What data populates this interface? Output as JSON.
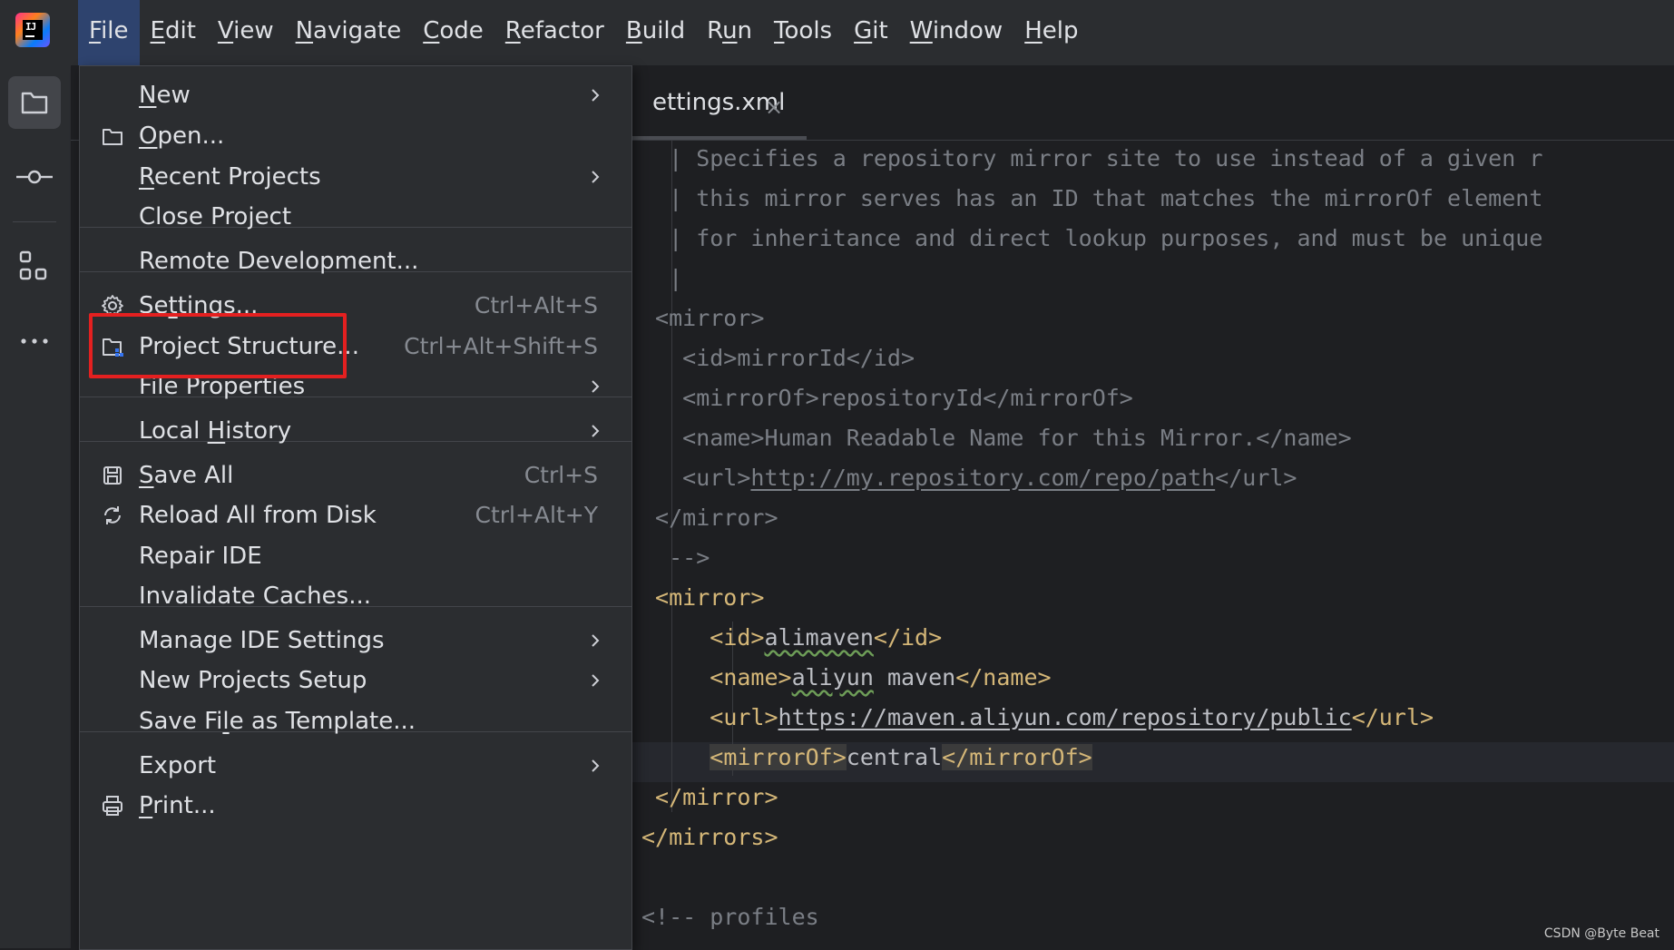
{
  "menubar": {
    "items": [
      "File",
      "Edit",
      "View",
      "Navigate",
      "Code",
      "Refactor",
      "Build",
      "Run",
      "Tools",
      "Git",
      "Window",
      "Help"
    ],
    "mnemonics": [
      "F",
      "E",
      "V",
      "N",
      "C",
      "R",
      "B",
      "u",
      "T",
      "G",
      "W",
      "H"
    ],
    "active": "File"
  },
  "logo": {
    "text": "IJ"
  },
  "toolbar": {
    "icons": [
      "folder-icon",
      "commit-icon",
      "structure-icon",
      "more-icon"
    ]
  },
  "editor_tab": {
    "label": "ettings.xml",
    "close": "×"
  },
  "file_menu": {
    "items": [
      {
        "label": "New",
        "ul": "N",
        "icon": "",
        "shortcut": "",
        "submenu": true
      },
      {
        "label": "Open...",
        "ul": "O",
        "icon": "folder-icon",
        "shortcut": "",
        "submenu": false
      },
      {
        "label": "Recent Projects",
        "ul": "R",
        "icon": "",
        "shortcut": "",
        "submenu": true
      },
      {
        "label": "Close Project",
        "ul": "",
        "icon": "",
        "shortcut": "",
        "submenu": false
      },
      {
        "label": "Remote Development...",
        "ul": "",
        "icon": "",
        "shortcut": "",
        "submenu": false
      },
      {
        "label": "Settings...",
        "ul": "t",
        "icon": "gear-icon",
        "shortcut": "Ctrl+Alt+S",
        "submenu": false
      },
      {
        "label": "Project Structure...",
        "ul": "",
        "icon": "project-structure-icon",
        "shortcut": "Ctrl+Alt+Shift+S",
        "submenu": false
      },
      {
        "label": "File Properties",
        "ul": "",
        "icon": "",
        "shortcut": "",
        "submenu": true
      },
      {
        "label": "Local History",
        "ul": "H",
        "icon": "",
        "shortcut": "",
        "submenu": true
      },
      {
        "label": "Save All",
        "ul": "S",
        "icon": "save-icon",
        "shortcut": "Ctrl+S",
        "submenu": false
      },
      {
        "label": "Reload All from Disk",
        "ul": "",
        "icon": "reload-icon",
        "shortcut": "Ctrl+Alt+Y",
        "submenu": false
      },
      {
        "label": "Repair IDE",
        "ul": "",
        "icon": "",
        "shortcut": "",
        "submenu": false
      },
      {
        "label": "Invalidate Caches...",
        "ul": "",
        "icon": "",
        "shortcut": "",
        "submenu": false
      },
      {
        "label": "Manage IDE Settings",
        "ul": "",
        "icon": "",
        "shortcut": "",
        "submenu": true
      },
      {
        "label": "New Projects Setup",
        "ul": "",
        "icon": "",
        "shortcut": "",
        "submenu": true
      },
      {
        "label": "Save File as Template...",
        "ul": "l",
        "icon": "",
        "shortcut": "",
        "submenu": false
      },
      {
        "label": "Export",
        "ul": "",
        "icon": "",
        "shortcut": "",
        "submenu": true
      },
      {
        "label": "Print...",
        "ul": "P",
        "icon": "print-icon",
        "shortcut": "",
        "submenu": false
      }
    ],
    "highlighted": "Settings..."
  },
  "code": {
    "lines": [
      {
        "kind": "comment",
        "text": "  | Specifies a repository mirror site to use instead of a given r"
      },
      {
        "kind": "comment",
        "text": "  | this mirror serves has an ID that matches the mirrorOf element"
      },
      {
        "kind": "comment",
        "text": "  | for inheritance and direct lookup purposes, and must be unique"
      },
      {
        "kind": "comment",
        "text": "  |"
      },
      {
        "kind": "comment",
        "text": " <mirror>"
      },
      {
        "kind": "comment",
        "text": "   <id>mirrorId</id>"
      },
      {
        "kind": "comment",
        "text": "   <mirrorOf>repositoryId</mirrorOf>"
      },
      {
        "kind": "comment",
        "text": "   <name>Human Readable Name for this Mirror.</name>"
      },
      {
        "kind": "comment_url",
        "pre": "   <url>",
        "url": "http://my.repository.com/repo/path",
        "post": "</url>"
      },
      {
        "kind": "comment",
        "text": " </mirror>"
      },
      {
        "kind": "comment",
        "text": "  -->"
      },
      {
        "kind": "tag",
        "text": " <mirror>"
      },
      {
        "kind": "elem",
        "open": "<id>",
        "value": "alimaven",
        "close": "</id>",
        "indent": "     "
      },
      {
        "kind": "elem",
        "open": "<name>",
        "value": "aliyun maven",
        "close": "</name>",
        "indent": "     "
      },
      {
        "kind": "url",
        "open": "<url>",
        "value": "https://maven.aliyun.com/repository/public",
        "close": "</url>",
        "indent": "     "
      },
      {
        "kind": "elem",
        "open": "<mirrorOf>",
        "value": "central",
        "close": "</mirrorOf>",
        "indent": "     "
      },
      {
        "kind": "tag",
        "text": " </mirror>"
      },
      {
        "kind": "tag",
        "text": "</mirrors>"
      },
      {
        "kind": "blank",
        "text": ""
      },
      {
        "kind": "comment",
        "text": "<!-- profiles"
      }
    ]
  },
  "watermark": "CSDN @Byte Beat",
  "colors": {
    "menu_bg": "#2b2d30",
    "editor_bg": "#1e1f22",
    "active_menu": "#2e436e",
    "highlight_box": "#e42020",
    "tag": "#d5b778",
    "comment": "#7a7e85",
    "text": "#bcbec4"
  }
}
